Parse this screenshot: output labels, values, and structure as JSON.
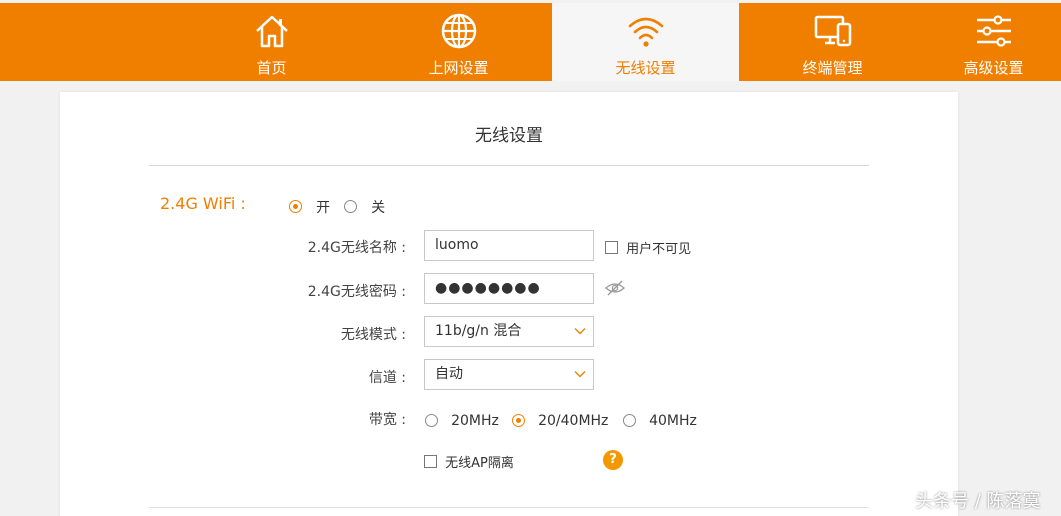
{
  "nav": {
    "items": [
      {
        "label": "首页",
        "icon": "home-icon"
      },
      {
        "label": "上网设置",
        "icon": "globe-icon"
      },
      {
        "label": "无线设置",
        "icon": "wifi-icon"
      },
      {
        "label": "终端管理",
        "icon": "devices-icon"
      },
      {
        "label": "高级设置",
        "icon": "sliders-icon"
      }
    ],
    "active": "无线设置"
  },
  "panel": {
    "title": "无线设置",
    "wifi": {
      "label": "2.4G WiFi :",
      "on_label": "开",
      "off_label": "关",
      "selected": "开"
    },
    "ssid": {
      "label": "2.4G无线名称 :",
      "value": "luomo",
      "hide_label": "用户不可见"
    },
    "password": {
      "label": "2.4G无线密码 :",
      "value": "●●●●●●●●"
    },
    "mode": {
      "label": "无线模式 :",
      "value": "11b/g/n 混合"
    },
    "channel": {
      "label": "信道 :",
      "value": "自动"
    },
    "bandwidth": {
      "label": "带宽 :",
      "options": [
        "20MHz",
        "20/40MHz",
        "40MHz"
      ],
      "selected": "20/40MHz"
    },
    "ap_isolation": {
      "label": "无线AP隔离",
      "help": "?"
    }
  },
  "watermark": "头条号 / 陈落寞",
  "colors": {
    "accent": "#f07f00",
    "help": "#f39800"
  }
}
